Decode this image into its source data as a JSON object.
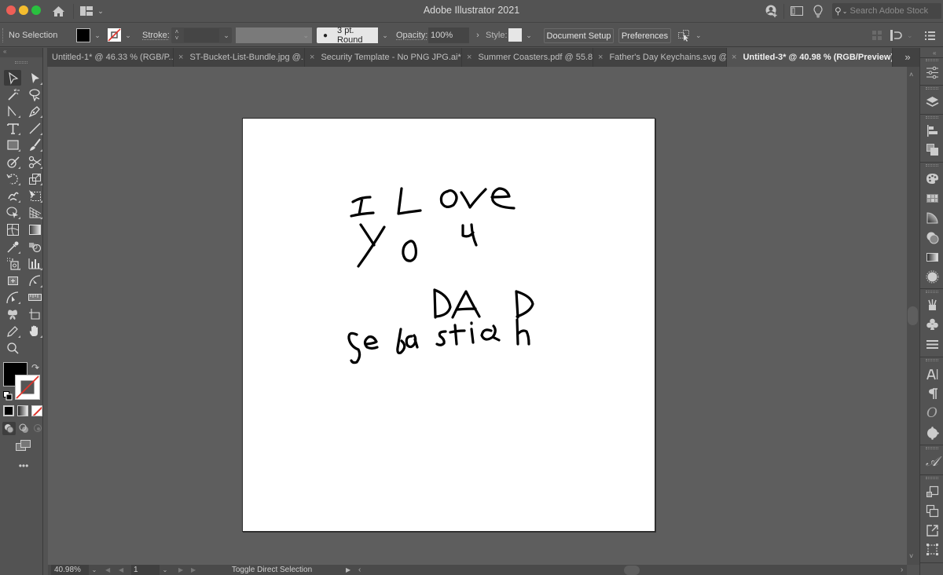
{
  "app": {
    "title": "Adobe Illustrator 2021",
    "stock_search_placeholder": "Search Adobe Stock"
  },
  "controlbar": {
    "selection_status": "No Selection",
    "fill_color": "#000000",
    "stroke_color": "none",
    "stroke_label": "Stroke:",
    "stroke_weight": "",
    "brush_profile": "3 pt. Round",
    "opacity_label": "Opacity:",
    "opacity_value": "100%",
    "style_label": "Style:",
    "document_setup_label": "Document Setup",
    "preferences_label": "Preferences"
  },
  "tabs": [
    {
      "label": "Untitled-1* @ 46.33 % (RGB/P...",
      "active": false
    },
    {
      "label": "ST-Bucket-List-Bundle.jpg @...",
      "active": false
    },
    {
      "label": "Security Template - No PNG JPG.ai*",
      "active": false
    },
    {
      "label": "Summer Coasters.pdf @ 55.8...",
      "active": false
    },
    {
      "label": "Father's Day Keychains.svg @...",
      "active": false
    },
    {
      "label": "Untitled-3* @ 40.98 % (RGB/Preview)",
      "active": true
    }
  ],
  "tabs_overflow_icon": "»",
  "artwork": {
    "lines": [
      "I Love",
      "Y O   u",
      "D A D",
      "Sebastian"
    ],
    "description": "Hand-drawn black text on white artboard"
  },
  "statusbar": {
    "zoom": "40.98%",
    "artboard_number": "1",
    "status_text": "Toggle Direct Selection"
  },
  "colors": {
    "ui_bg": "#535353",
    "canvas_bg": "#5e5e5e",
    "artboard": "#ffffff",
    "stroke_none_red": "#e0342b",
    "close_red": "#ee5f57",
    "minimize_yellow": "#f5bd2f",
    "zoom_green": "#29c13f"
  }
}
